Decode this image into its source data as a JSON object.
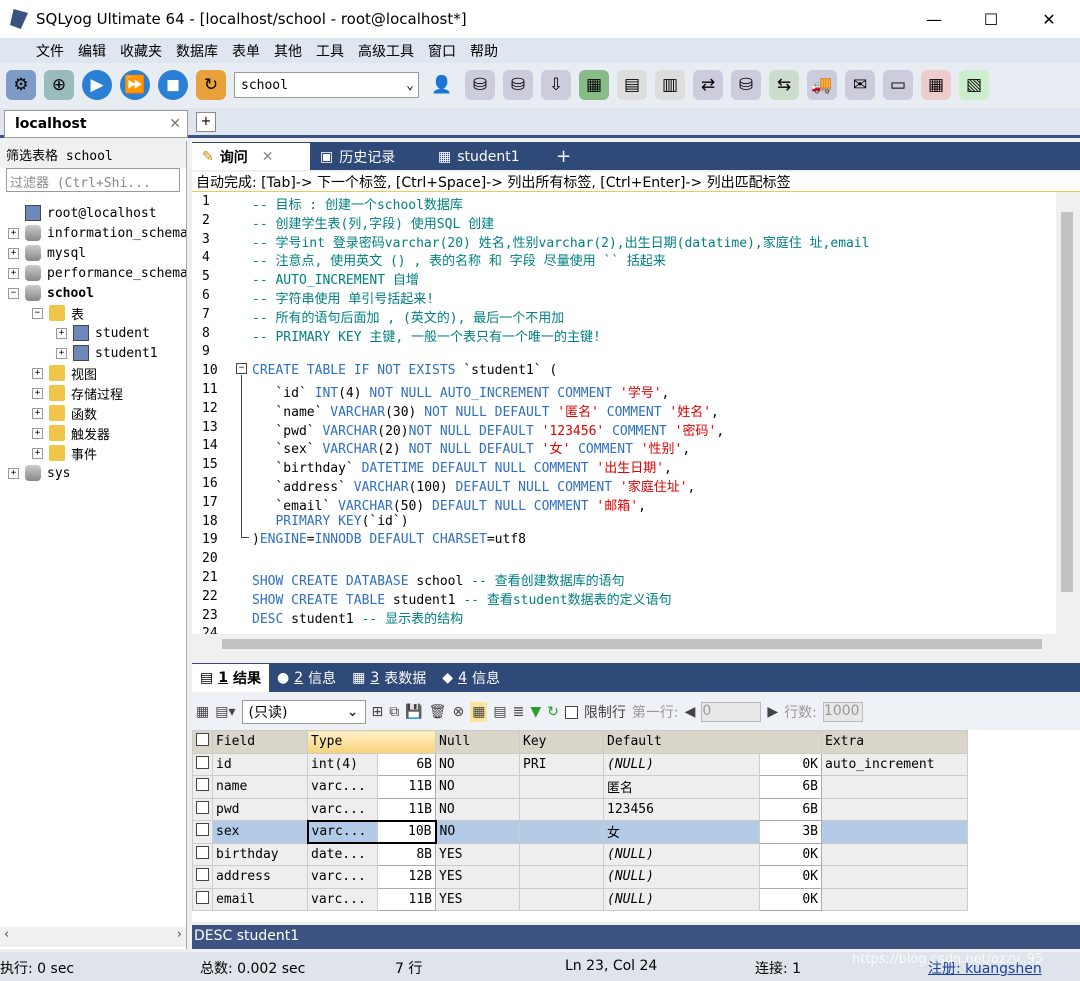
{
  "window": {
    "title": "SQLyog Ultimate 64 - [localhost/school - root@localhost*]",
    "min": "—",
    "max": "☐",
    "close": "✕"
  },
  "menu": [
    "文件",
    "编辑",
    "收藏夹",
    "数据库",
    "表单",
    "其他",
    "工具",
    "高级工具",
    "窗口",
    "帮助"
  ],
  "toolbar": {
    "database": "school"
  },
  "connection_tab": {
    "label": "localhost",
    "close": "✕",
    "add": "+"
  },
  "left": {
    "filter_label": "筛选表格 school",
    "filter_placeholder": "过滤器 (Ctrl+Shi...",
    "tree": [
      {
        "label": "root@localhost",
        "level": 0,
        "icon": "server",
        "exp": ""
      },
      {
        "label": "information_schema",
        "level": 0,
        "icon": "db",
        "exp": "+"
      },
      {
        "label": "mysql",
        "level": 0,
        "icon": "db",
        "exp": "+"
      },
      {
        "label": "performance_schema",
        "level": 0,
        "icon": "db",
        "exp": "+"
      },
      {
        "label": "school",
        "level": 0,
        "icon": "db",
        "exp": "−",
        "bold": true
      },
      {
        "label": "表",
        "level": 1,
        "icon": "folder",
        "exp": "−"
      },
      {
        "label": "student",
        "level": 2,
        "icon": "table",
        "exp": "+"
      },
      {
        "label": "student1",
        "level": 2,
        "icon": "table",
        "exp": "+"
      },
      {
        "label": "视图",
        "level": 1,
        "icon": "folder",
        "exp": "+"
      },
      {
        "label": "存储过程",
        "level": 1,
        "icon": "folder",
        "exp": "+"
      },
      {
        "label": "函数",
        "level": 1,
        "icon": "folder",
        "exp": "+"
      },
      {
        "label": "触发器",
        "level": 1,
        "icon": "folder",
        "exp": "+"
      },
      {
        "label": "事件",
        "level": 1,
        "icon": "folder",
        "exp": "+"
      },
      {
        "label": "sys",
        "level": 0,
        "icon": "db",
        "exp": "+"
      }
    ]
  },
  "editor_tabs": [
    {
      "label": "询问",
      "active": true,
      "close": "✕"
    },
    {
      "label": "历史记录"
    },
    {
      "label": "student1"
    }
  ],
  "hint": "自动完成: [Tab]-> 下一个标签, [Ctrl+Space]-> 列出所有标签, [Ctrl+Enter]-> 列出匹配标签",
  "code": [
    [
      [
        "-- 目标 : 创建一个school数据库",
        "c"
      ]
    ],
    [
      [
        "-- 创建学生表(列,字段) 使用SQL 创建",
        "c"
      ]
    ],
    [
      [
        "-- 学号int 登录密码varchar(20) 姓名,性别varchar(2),出生日期(datatime),家庭住 址,email",
        "c"
      ]
    ],
    [
      [
        "-- 注意点, 使用英文 () , 表的名称 和 字段 尽量使用 `` 括起来",
        "c"
      ]
    ],
    [
      [
        "-- AUTO_INCREMENT 自增",
        "c"
      ]
    ],
    [
      [
        "-- 字符串使用 单引号括起来!",
        "c"
      ]
    ],
    [
      [
        "-- 所有的语句后面加 , (英文的), 最后一个不用加",
        "c"
      ]
    ],
    [
      [
        "-- PRIMARY KEY 主键, 一般一个表只有一个唯一的主键!",
        "c"
      ]
    ],
    [],
    [
      [
        "CREATE TABLE IF NOT EXISTS ",
        "k"
      ],
      [
        "`student1` (",
        "i"
      ]
    ],
    [
      [
        "   `id` ",
        "i"
      ],
      [
        "INT",
        "k"
      ],
      [
        "(4) ",
        "i"
      ],
      [
        "NOT NULL AUTO_INCREMENT COMMENT ",
        "k"
      ],
      [
        "'学号'",
        "s"
      ],
      [
        ",",
        "i"
      ]
    ],
    [
      [
        "   `name` ",
        "i"
      ],
      [
        "VARCHAR",
        "k"
      ],
      [
        "(30) ",
        "i"
      ],
      [
        "NOT NULL DEFAULT ",
        "k"
      ],
      [
        "'匿名'",
        "s"
      ],
      [
        " COMMENT ",
        "k"
      ],
      [
        "'姓名'",
        "s"
      ],
      [
        ",",
        "i"
      ]
    ],
    [
      [
        "   `pwd` ",
        "i"
      ],
      [
        "VARCHAR",
        "k"
      ],
      [
        "(20)",
        "i"
      ],
      [
        "NOT NULL DEFAULT ",
        "k"
      ],
      [
        "'123456'",
        "s"
      ],
      [
        " COMMENT ",
        "k"
      ],
      [
        "'密码'",
        "s"
      ],
      [
        ",",
        "i"
      ]
    ],
    [
      [
        "   `sex` ",
        "i"
      ],
      [
        "VARCHAR",
        "k"
      ],
      [
        "(2) ",
        "i"
      ],
      [
        "NOT NULL DEFAULT ",
        "k"
      ],
      [
        "'女'",
        "s"
      ],
      [
        " COMMENT ",
        "k"
      ],
      [
        "'性别'",
        "s"
      ],
      [
        ",",
        "i"
      ]
    ],
    [
      [
        "   `birthday` ",
        "i"
      ],
      [
        "DATETIME DEFAULT NULL COMMENT ",
        "k"
      ],
      [
        "'出生日期'",
        "s"
      ],
      [
        ",",
        "i"
      ]
    ],
    [
      [
        "   `address` ",
        "i"
      ],
      [
        "VARCHAR",
        "k"
      ],
      [
        "(100) ",
        "i"
      ],
      [
        "DEFAULT NULL COMMENT ",
        "k"
      ],
      [
        "'家庭住址'",
        "s"
      ],
      [
        ",",
        "i"
      ]
    ],
    [
      [
        "   `email` ",
        "i"
      ],
      [
        "VARCHAR",
        "k"
      ],
      [
        "(50) ",
        "i"
      ],
      [
        "DEFAULT NULL COMMENT ",
        "k"
      ],
      [
        "'邮箱'",
        "s"
      ],
      [
        ",",
        "i"
      ]
    ],
    [
      [
        "   PRIMARY KEY",
        "k"
      ],
      [
        "(`id`)",
        "i"
      ]
    ],
    [
      [
        ")",
        "i"
      ],
      [
        "ENGINE",
        "k"
      ],
      [
        "=",
        "i"
      ],
      [
        "INNODB DEFAULT CHARSET",
        "k"
      ],
      [
        "=utf8",
        "i"
      ]
    ],
    [],
    [
      [
        "SHOW CREATE DATABASE ",
        "k"
      ],
      [
        "school ",
        "i"
      ],
      [
        "-- 查看创建数据库的语句",
        "c"
      ]
    ],
    [
      [
        "SHOW CREATE TABLE ",
        "k"
      ],
      [
        "student1 ",
        "i"
      ],
      [
        "-- 查看student数据表的定义语句",
        "c"
      ]
    ],
    [
      [
        "DESC ",
        "k"
      ],
      [
        "student1 ",
        "i"
      ],
      [
        "-- 显示表的结构",
        "c"
      ]
    ],
    []
  ],
  "result_tabs": [
    {
      "num": "1",
      "label": "结果",
      "active": true
    },
    {
      "num": "2",
      "label": "信息"
    },
    {
      "num": "3",
      "label": "表数据"
    },
    {
      "num": "4",
      "label": "信息"
    }
  ],
  "result_toolbar": {
    "mode": "(只读)",
    "limit_label": "限制行",
    "first_row_label": "第一行:",
    "first_row": "0",
    "rows_label": "行数:",
    "rows": "1000"
  },
  "grid": {
    "columns": [
      "Field",
      "Type",
      "Null",
      "Key",
      "Default",
      "Extra"
    ],
    "rows": [
      {
        "field": "id",
        "type": "int(4)",
        "type_len": "6B",
        "null": "NO",
        "key": "PRI",
        "default": "(NULL)",
        "default_len": "0K",
        "extra": "auto_increment"
      },
      {
        "field": "name",
        "type": "varc...",
        "type_len": "11B",
        "null": "NO",
        "key": "",
        "default": "匿名",
        "default_len": "6B",
        "extra": ""
      },
      {
        "field": "pwd",
        "type": "varc...",
        "type_len": "11B",
        "null": "NO",
        "key": "",
        "default": "123456",
        "default_len": "6B",
        "extra": ""
      },
      {
        "field": "sex",
        "type": "varc...",
        "type_len": "10B",
        "null": "NO",
        "key": "",
        "default": "女",
        "default_len": "3B",
        "extra": "",
        "selected": true
      },
      {
        "field": "birthday",
        "type": "date...",
        "type_len": "8B",
        "null": "YES",
        "key": "",
        "default": "(NULL)",
        "default_len": "0K",
        "extra": ""
      },
      {
        "field": "address",
        "type": "varc...",
        "type_len": "12B",
        "null": "YES",
        "key": "",
        "default": "(NULL)",
        "default_len": "0K",
        "extra": ""
      },
      {
        "field": "email",
        "type": "varc...",
        "type_len": "11B",
        "null": "YES",
        "key": "",
        "default": "(NULL)",
        "default_len": "0K",
        "extra": ""
      }
    ]
  },
  "sql_status": "DESC student1",
  "status": {
    "exec": "执行: 0 sec",
    "total": "总数: 0.002 sec",
    "rows": "7 行",
    "pos": "Ln 23, Col 24",
    "conn": "连接: 1",
    "reg": "注册: kuangshen",
    "watermark": "https://blog.csdn.net/ozzy..95"
  },
  "colors": {
    "accent": "#2f4a78",
    "comment": "#008080",
    "keyword": "#2f6fc0",
    "string": "#e00000",
    "selected_row": "#b4cbe8"
  }
}
